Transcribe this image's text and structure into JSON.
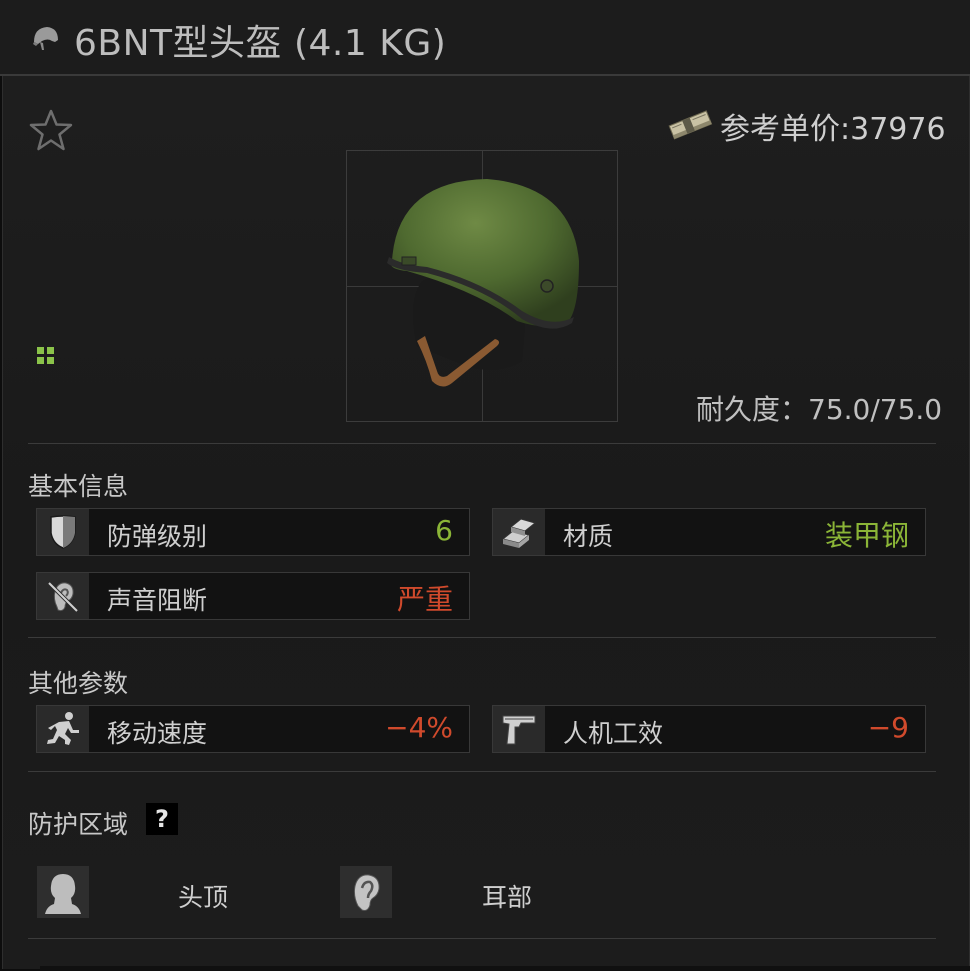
{
  "title": "6BNT型头盔 (4.1 KG)",
  "price": {
    "label": "参考单价:",
    "value": "37976"
  },
  "durability": "耐久度：75.0/75.0",
  "basic_info": {
    "heading": "基本信息",
    "stats": [
      {
        "icon": "armor-shield-icon",
        "label": "防弹级别",
        "value": "6",
        "color": "#8bb537"
      },
      {
        "icon": "material-ingots-icon",
        "label": "材质",
        "value": "装甲钢",
        "color": "#8bb537"
      },
      {
        "icon": "sound-block-ear-icon",
        "label": "声音阻断",
        "value": "严重",
        "color": "#d04a2c"
      }
    ]
  },
  "other_params": {
    "heading": "其他参数",
    "stats": [
      {
        "icon": "running-man-icon",
        "label": "移动速度",
        "value": "−4%",
        "color": "#d04a2c"
      },
      {
        "icon": "pistol-icon",
        "label": "人机工效",
        "value": "−9",
        "color": "#d04a2c"
      }
    ]
  },
  "protection": {
    "heading": "防护区域",
    "help": "?",
    "zones": [
      {
        "icon": "head-silhouette-icon",
        "label": "头顶"
      },
      {
        "icon": "ear-icon",
        "label": "耳部"
      }
    ]
  },
  "colors": {
    "accent_green": "#8bb537",
    "accent_red": "#d04a2c",
    "background": "#1c1c1c"
  }
}
